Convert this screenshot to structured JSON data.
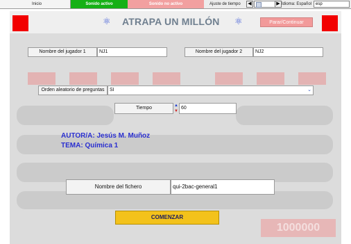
{
  "topbar": {
    "inicio": "Inicio",
    "sound_on": "Sonido activo",
    "sound_off": "Sonido no activo",
    "time_adjust_label": "Ajuste de tiempo",
    "language_label": "Idioma: Español",
    "language_value": "esp"
  },
  "header": {
    "title": "ATRAPA UN MILLÓN",
    "pause_button": "Parar/Continuar"
  },
  "form": {
    "player1_label": "Nombre del jugador 1",
    "player1_value": "NJ1",
    "player2_label": "Nombre del jugador 2",
    "player2_value": "NJ2",
    "random_order_label": "Orden aleatorio de preguntas",
    "random_order_value": "SI",
    "time_label": "Tiempo",
    "time_value": "60",
    "file_label": "Nombre del fichero",
    "file_value": "qui-2bac-general1",
    "start_button": "COMENZAR"
  },
  "credits": {
    "author": "AUTOR/A: Jesús M. Muñoz",
    "topic": "TEMA: Química 1"
  },
  "background": {
    "prize": "1000000"
  },
  "colors": {
    "sound_on_bg": "#16b016",
    "sound_off_bg": "#f2a0a0",
    "red_square": "#f20000",
    "title_color": "#6f7f8f",
    "credits_color": "#2a2fd0",
    "start_button_bg": "#f3c21b"
  }
}
